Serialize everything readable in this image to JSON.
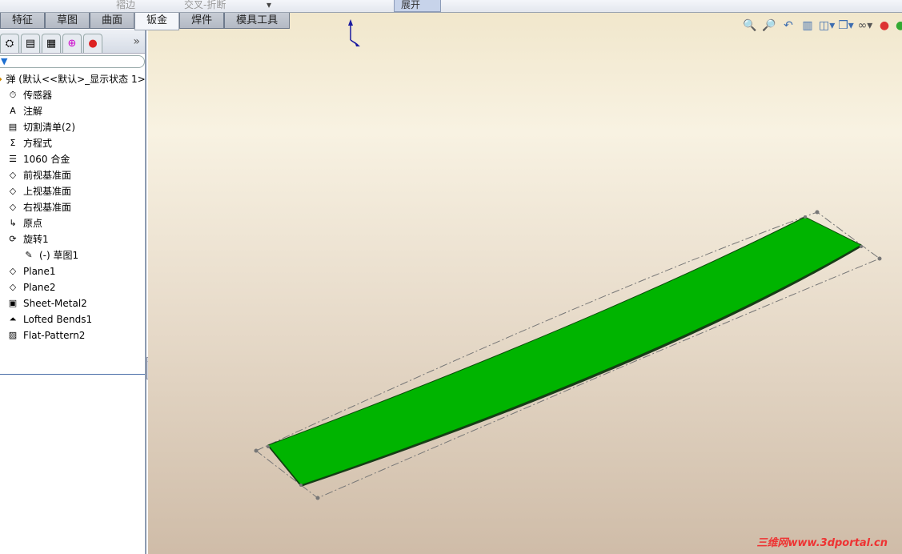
{
  "toolbar": {
    "items": [
      "褶边",
      "交叉-折断",
      "展开"
    ]
  },
  "tabs": [
    "特征",
    "草图",
    "曲面",
    "钣金",
    "焊件",
    "模具工具"
  ],
  "selected_tab": "钣金",
  "panel": {
    "more": "»",
    "root": "弹  (默认<<默认>_显示状态 1>",
    "items": [
      {
        "label": "传感器",
        "icon": "sensor-icon"
      },
      {
        "label": "注解",
        "icon": "annotation-icon"
      },
      {
        "label": "切割清单(2)",
        "icon": "cut-list-icon"
      },
      {
        "label": "方程式",
        "icon": "equation-icon"
      },
      {
        "label": "1060 合金",
        "icon": "material-icon"
      },
      {
        "label": "前视基准面",
        "icon": "plane-icon"
      },
      {
        "label": "上视基准面",
        "icon": "plane-icon"
      },
      {
        "label": "右视基准面",
        "icon": "plane-icon"
      },
      {
        "label": "原点",
        "icon": "origin-icon"
      },
      {
        "label": "旋转1",
        "icon": "revolve-icon"
      },
      {
        "label": "(-) 草图1",
        "icon": "sketch-icon",
        "child": true
      },
      {
        "label": "Plane1",
        "icon": "plane-icon"
      },
      {
        "label": "Plane2",
        "icon": "plane-icon"
      },
      {
        "label": "Sheet-Metal2",
        "icon": "sheet-metal-icon"
      },
      {
        "label": "Lofted Bends1",
        "icon": "lofted-bends-icon"
      },
      {
        "label": "Flat-Pattern2",
        "icon": "flat-pattern-icon"
      }
    ]
  },
  "watermark": "三维网www.3dportal.cn",
  "colors": {
    "part": "#00b400",
    "accent": "#1a1aa0"
  }
}
